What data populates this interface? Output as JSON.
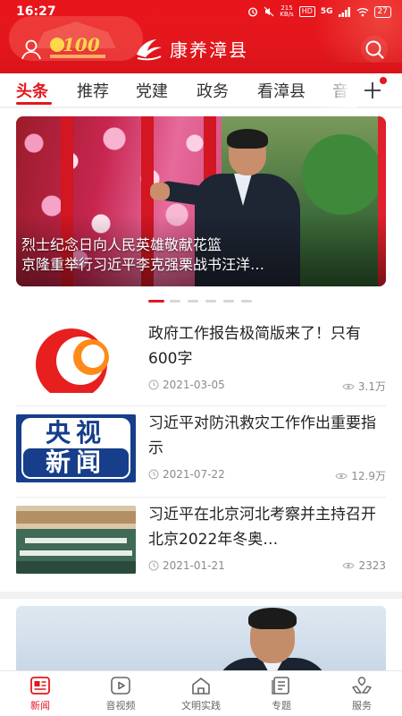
{
  "status_bar": {
    "time": "16:27",
    "net_speed": "215\nKB/s",
    "hd": "HD",
    "signal": "5G",
    "battery": "27"
  },
  "header": {
    "brand_name": "康养漳县",
    "emblem_number": "100",
    "colors": {
      "primary": "#e3171d"
    }
  },
  "tabs": [
    {
      "label": "头条",
      "active": true
    },
    {
      "label": "推荐"
    },
    {
      "label": "党建"
    },
    {
      "label": "政务"
    },
    {
      "label": "看漳县"
    },
    {
      "label": "音"
    }
  ],
  "carousel": {
    "title_line1": "烈士纪念日向人民英雄敬献花篮",
    "title_line2": "京隆重举行习近平李克强栗战书汪洋…",
    "page_count": 6,
    "active_index": 0
  },
  "news": [
    {
      "title": "政府工作报告极简版来了！只有600字",
      "date": "2021-03-05",
      "views": "3.1万",
      "thumb": "orange-logo"
    },
    {
      "title": "习近平对防汛救灾工作作出重要指示",
      "date": "2021-07-22",
      "views": "12.9万",
      "thumb": "cctv-news",
      "thumb_text_line1": "央视",
      "thumb_text_line2": "新闻"
    },
    {
      "title": "习近平在北京河北考察并主持召开北京2022年冬奥…",
      "date": "2021-01-21",
      "views": "2323",
      "thumb": "meeting-photo"
    }
  ],
  "bottom_nav": [
    {
      "label": "新闻",
      "icon": "news-icon",
      "active": true
    },
    {
      "label": "音视频",
      "icon": "video-icon"
    },
    {
      "label": "文明实践",
      "icon": "civilization-icon"
    },
    {
      "label": "专题",
      "icon": "topic-icon"
    },
    {
      "label": "服务",
      "icon": "service-icon"
    }
  ]
}
